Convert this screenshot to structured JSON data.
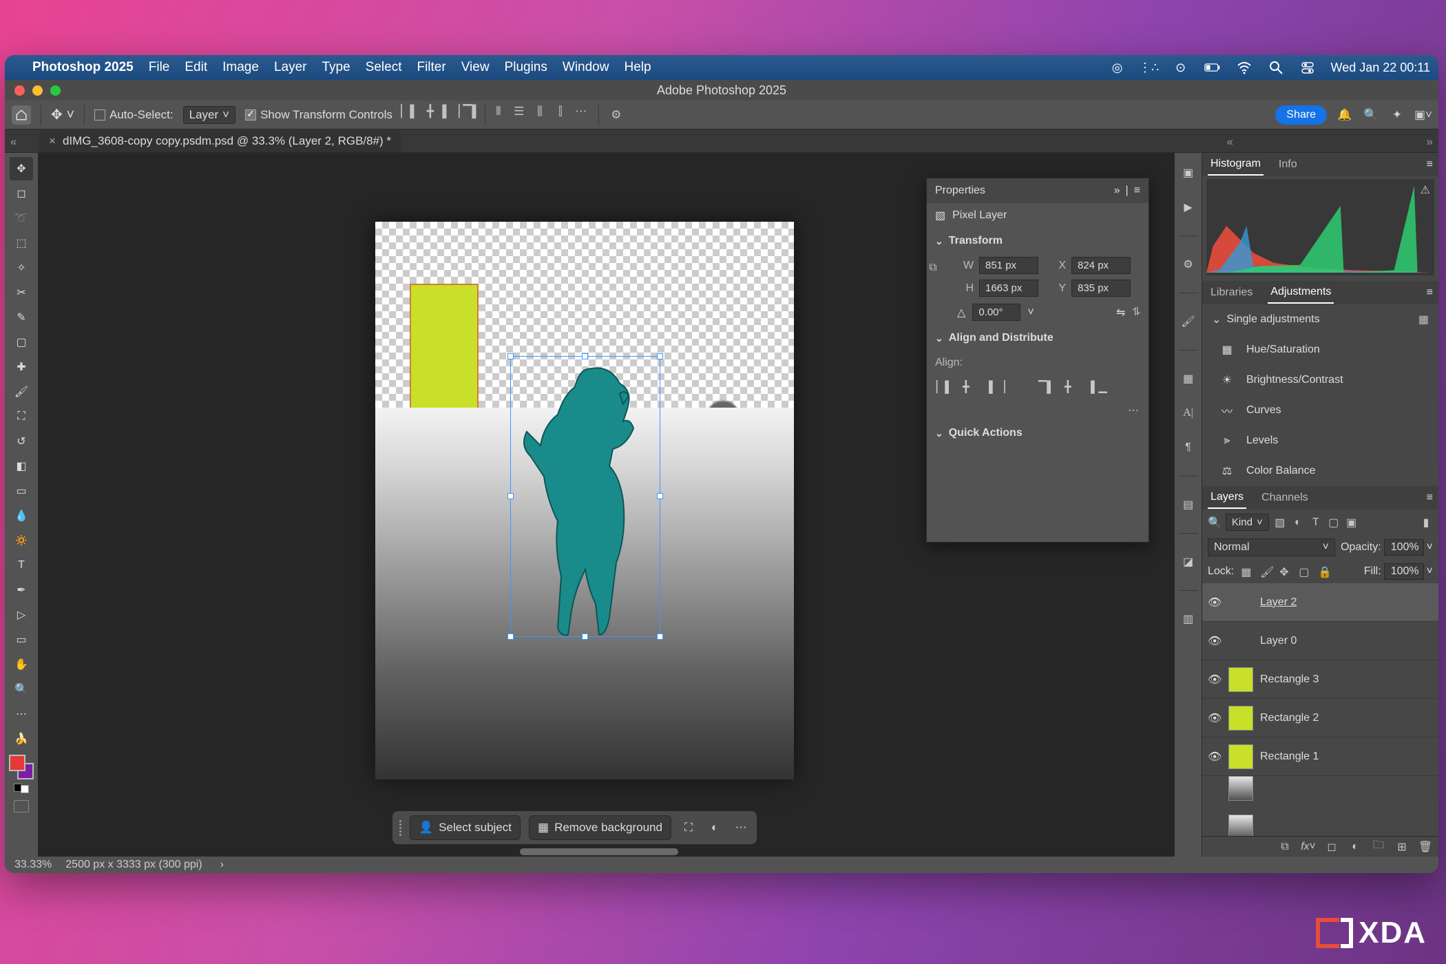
{
  "mac": {
    "appname": "Photoshop 2025",
    "menus": [
      "File",
      "Edit",
      "Image",
      "Layer",
      "Type",
      "Select",
      "Filter",
      "View",
      "Plugins",
      "Window",
      "Help"
    ],
    "clock": "Wed Jan 22  00:11"
  },
  "window": {
    "title": "Adobe Photoshop 2025"
  },
  "options": {
    "auto_select_label": "Auto-Select:",
    "auto_select_target": "Layer",
    "auto_select_checked": false,
    "show_transform_label": "Show Transform Controls",
    "show_transform_checked": true,
    "share_label": "Share"
  },
  "tab": {
    "title": "dIMG_3608-copy copy.psdm.psd @ 33.3% (Layer 2, RGB/8#) *"
  },
  "context_bar": {
    "select_subject": "Select subject",
    "remove_bg": "Remove background"
  },
  "properties": {
    "panel_title": "Properties",
    "layer_type": "Pixel Layer",
    "sections": {
      "transform": "Transform",
      "align": "Align and Distribute",
      "quick": "Quick Actions"
    },
    "align_label": "Align:",
    "transform": {
      "w": "851 px",
      "h": "1663 px",
      "x": "824 px",
      "y": "835 px",
      "angle": "0.00°"
    }
  },
  "panels": {
    "histogram_tabs": [
      "Histogram",
      "Info"
    ],
    "lib_adj_tabs": [
      "Libraries",
      "Adjustments"
    ],
    "adjustments_header": "Single adjustments",
    "adjustments": [
      "Hue/Saturation",
      "Brightness/Contrast",
      "Curves",
      "Levels",
      "Color Balance"
    ],
    "layers_tabs": [
      "Layers",
      "Channels"
    ],
    "filter_label": "Kind",
    "blend_mode": "Normal",
    "opacity_label": "Opacity:",
    "opacity_value": "100%",
    "lock_label": "Lock:",
    "fill_label": "Fill:",
    "fill_value": "100%",
    "layers": [
      {
        "name": "Layer 2",
        "selected": true,
        "thumb": "photo",
        "underline": true
      },
      {
        "name": "Layer 0",
        "selected": false,
        "thumb": "photo"
      },
      {
        "name": "Rectangle 3",
        "selected": false,
        "thumb": "y"
      },
      {
        "name": "Rectangle 2",
        "selected": false,
        "thumb": "y"
      },
      {
        "name": "Rectangle 1",
        "selected": false,
        "thumb": "y"
      }
    ]
  },
  "status": {
    "zoom": "33.33%",
    "docinfo": "2500 px x 3333 px (300 ppi)"
  },
  "logo": "XDA"
}
